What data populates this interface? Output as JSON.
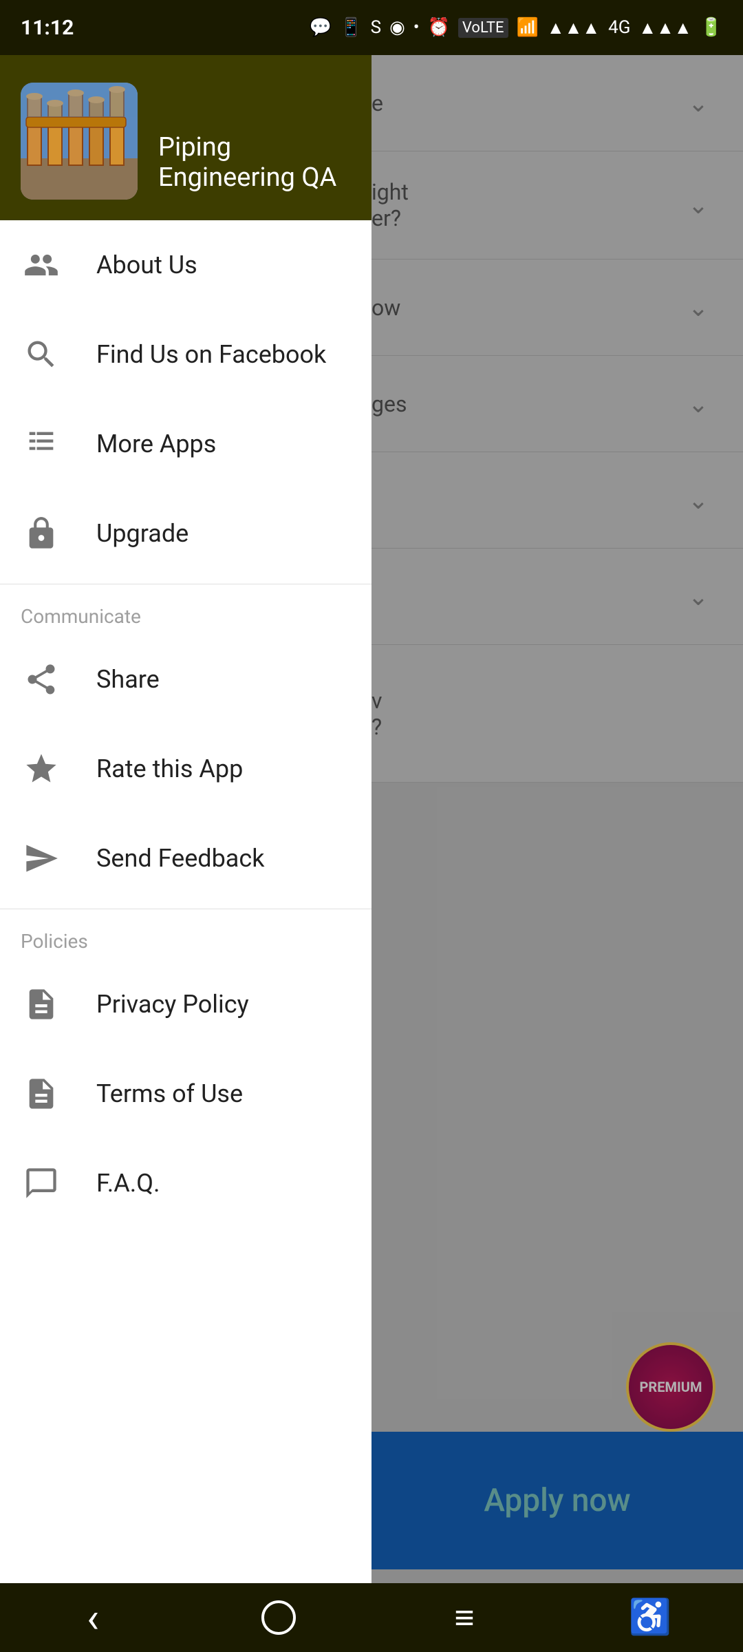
{
  "statusBar": {
    "time": "11:12",
    "icons": [
      "💬",
      "📱",
      "S",
      "◉",
      "•"
    ]
  },
  "drawer": {
    "appName": "Piping Engineering QA",
    "menuItems": [
      {
        "id": "about-us",
        "label": "About Us",
        "icon": "people"
      },
      {
        "id": "find-facebook",
        "label": "Find Us on Facebook",
        "icon": "search"
      },
      {
        "id": "more-apps",
        "label": "More Apps",
        "icon": "apps"
      },
      {
        "id": "upgrade",
        "label": "Upgrade",
        "icon": "lock"
      }
    ],
    "sections": [
      {
        "id": "communicate",
        "label": "Communicate",
        "items": [
          {
            "id": "share",
            "label": "Share",
            "icon": "share"
          },
          {
            "id": "rate-app",
            "label": "Rate this App",
            "icon": "star"
          },
          {
            "id": "send-feedback",
            "label": "Send Feedback",
            "icon": "send"
          }
        ]
      },
      {
        "id": "policies",
        "label": "Policies",
        "items": [
          {
            "id": "privacy-policy",
            "label": "Privacy Policy",
            "icon": "document"
          },
          {
            "id": "terms-of-use",
            "label": "Terms of Use",
            "icon": "document"
          },
          {
            "id": "faq",
            "label": "F.A.Q.",
            "icon": "chat"
          }
        ]
      }
    ]
  },
  "background": {
    "items": [
      {
        "text": "e",
        "partial": "ght\ner?"
      },
      {
        "text": "igh\ner?",
        "partial": ""
      },
      {
        "text": "",
        "partial": "ow"
      },
      {
        "text": "",
        "partial": "ges"
      },
      {
        "text": "",
        "partial": ""
      },
      {
        "text": "",
        "partial": ""
      },
      {
        "text": "",
        "partial": ""
      }
    ],
    "applyNow": "Apply now",
    "premiumLabel": "PREMIUM"
  },
  "bottomNav": {
    "back": "‹",
    "home": "○",
    "menu": "≡",
    "accessibility": "♿"
  }
}
